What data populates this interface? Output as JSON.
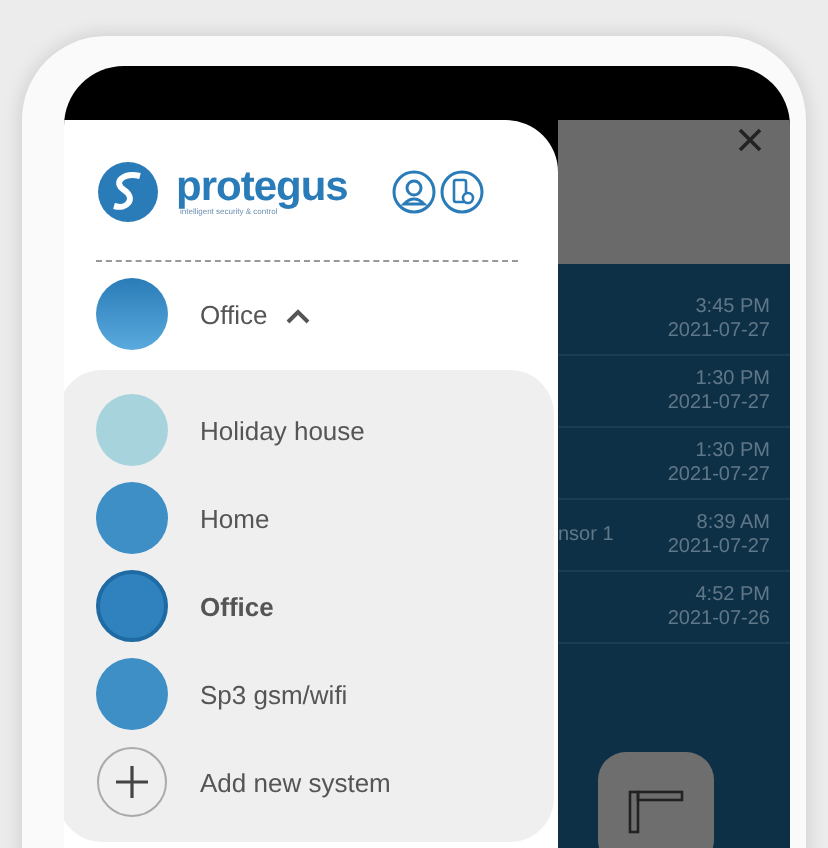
{
  "logo": {
    "name": "protegus",
    "tagline": "intelligent security & control"
  },
  "current_system": {
    "name": "Office",
    "expanded": true
  },
  "systems": [
    {
      "name": "Holiday house",
      "selected": false,
      "color": "#a6d3dc"
    },
    {
      "name": "Home",
      "selected": false,
      "color": "#3d8fc6"
    },
    {
      "name": "Office",
      "selected": true,
      "color": "#2f82bd"
    },
    {
      "name": "Sp3 gsm/wifi",
      "selected": false,
      "color": "#3d8fc6"
    }
  ],
  "add_system": {
    "label": "Add new system"
  },
  "events": [
    {
      "time": "3:45 PM",
      "date": "2021-07-27"
    },
    {
      "time": "1:30 PM",
      "date": "2021-07-27"
    },
    {
      "time": "1:30 PM",
      "date": "2021-07-27"
    },
    {
      "label": "nsor 1",
      "time": "8:39 AM",
      "date": "2021-07-27"
    },
    {
      "time": "4:52 PM",
      "date": "2021-07-26"
    }
  ]
}
